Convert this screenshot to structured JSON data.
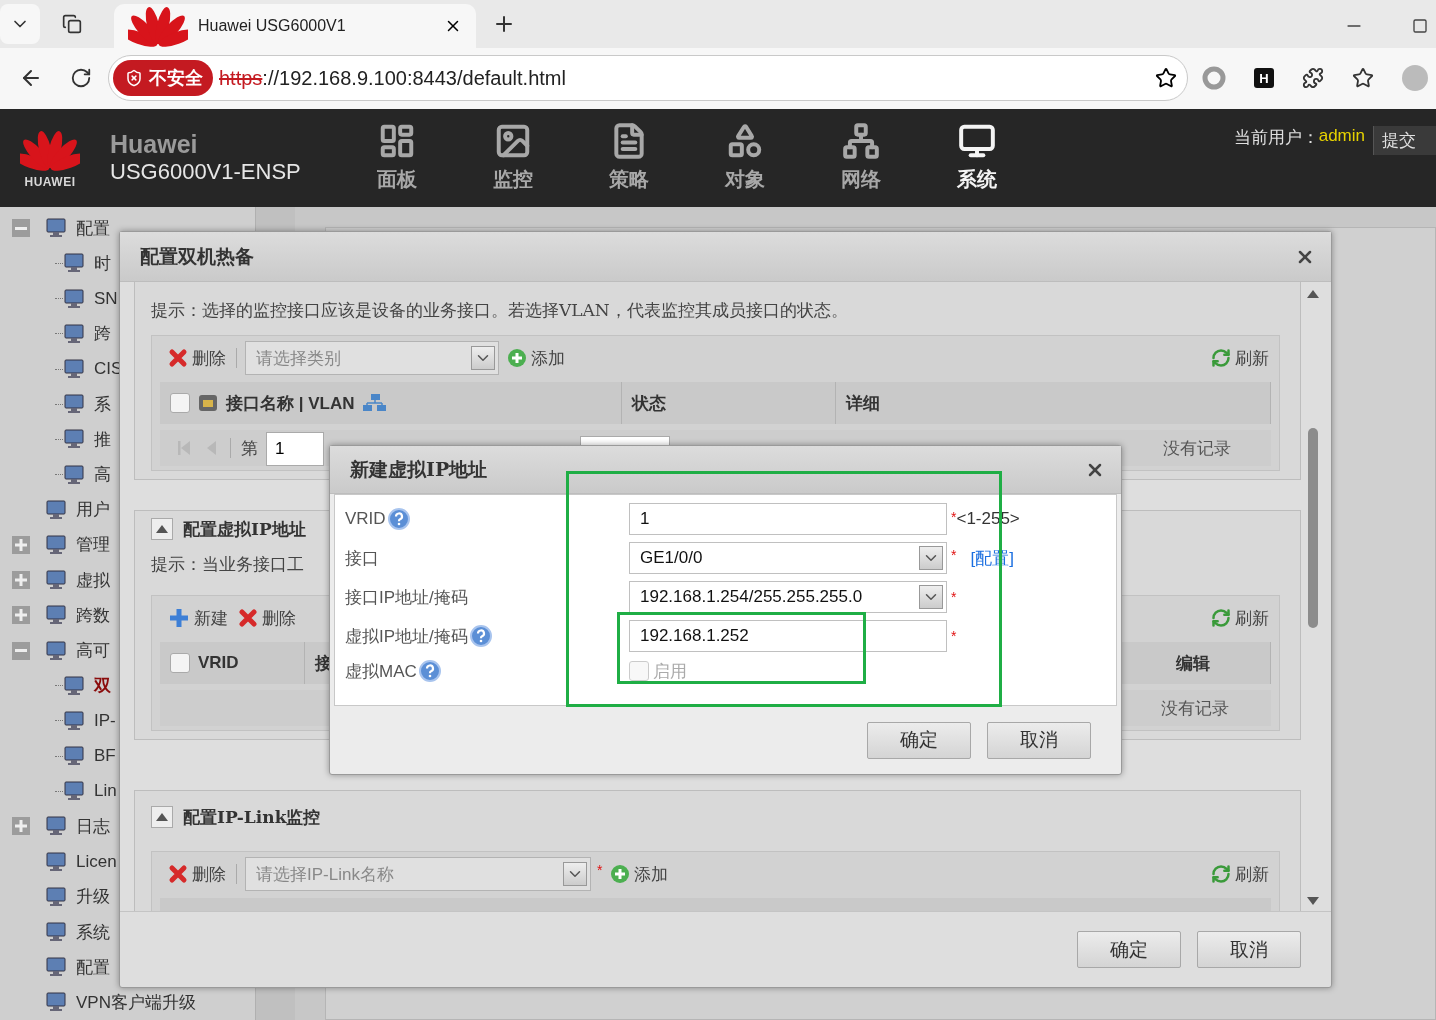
{
  "browser": {
    "tab_title": "Huawei USG6000V1",
    "security_badge": "不安全",
    "url_scheme": "https",
    "url_rest": "://192.168.9.100:8443/default.html",
    "extension_badge": "H"
  },
  "header": {
    "logo_text": "HUAWEI",
    "brand": "Huawei",
    "device": "USG6000V1-ENSP",
    "nav": [
      {
        "label": "面板",
        "kind": "panel",
        "selected": false
      },
      {
        "label": "监控",
        "kind": "monitor",
        "selected": false
      },
      {
        "label": "策略",
        "kind": "policy",
        "selected": false
      },
      {
        "label": "对象",
        "kind": "object",
        "selected": false
      },
      {
        "label": "网络",
        "kind": "network",
        "selected": false
      },
      {
        "label": "系统",
        "kind": "system",
        "selected": true
      }
    ],
    "user_label": "当前用户：",
    "user": "admin",
    "submit": "提交"
  },
  "sidebar": {
    "items": [
      {
        "label": "配置",
        "kind": "folder",
        "expanded": true,
        "children": [
          {
            "label": "时",
            "selected": false
          },
          {
            "label": "SN",
            "selected": false
          },
          {
            "label": "跨",
            "selected": false
          },
          {
            "label": "CIS",
            "selected": false
          },
          {
            "label": "系",
            "selected": false
          },
          {
            "label": "推",
            "selected": false
          },
          {
            "label": "高",
            "selected": false
          }
        ]
      },
      {
        "label": "用户",
        "kind": "leaf"
      },
      {
        "label": "管理",
        "kind": "folder",
        "expanded": false
      },
      {
        "label": "虚拟",
        "kind": "folder",
        "expanded": false
      },
      {
        "label": "跨数",
        "kind": "folder",
        "expanded": false
      },
      {
        "label": "高可",
        "kind": "folder",
        "expanded": true,
        "children": [
          {
            "label": "双",
            "selected": true
          },
          {
            "label": "IP-",
            "selected": false
          },
          {
            "label": "BF",
            "selected": false
          },
          {
            "label": "Lin",
            "selected": false
          }
        ]
      },
      {
        "label": "日志",
        "kind": "folder",
        "expanded": false
      },
      {
        "label": "Licen",
        "kind": "leaf"
      },
      {
        "label": "升级",
        "kind": "leaf"
      },
      {
        "label": "系统",
        "kind": "leaf"
      },
      {
        "label": "配置",
        "kind": "leaf"
      },
      {
        "label": "VPN客户端升级",
        "kind": "leaf"
      }
    ]
  },
  "ha_dialog": {
    "title": "配置双机热备",
    "monitor": {
      "hint": "提示：选择的监控接口应该是设备的业务接口。若选择VLAN，代表监控其成员接口的状态。",
      "delete": "删除",
      "category_placeholder": "请选择类别",
      "add": "添加",
      "refresh": "刷新",
      "select_all": false,
      "columns": [
        "接口名称 | VLAN",
        "状态",
        "详细"
      ],
      "pager": {
        "page_prefix": "第",
        "page": "1"
      },
      "empty": "没有记录"
    },
    "vip": {
      "title": "配置虚拟IP地址",
      "expanded": true,
      "hint": "提示：当业务接口工",
      "new": "新建",
      "delete": "删除",
      "refresh": "刷新",
      "select_all": false,
      "columns": [
        "VRID",
        "接",
        "编辑"
      ],
      "empty": "没有记录"
    },
    "iplink": {
      "title": "配置IP-Link监控",
      "expanded": true,
      "delete": "删除",
      "placeholder": "请选择IP-Link名称",
      "required_mark": "*",
      "add": "添加",
      "refresh": "刷新"
    },
    "buttons": [
      "确定",
      "取消"
    ]
  },
  "vip_dialog": {
    "title": "新建虚拟IP地址",
    "fields": [
      {
        "label": "VRID",
        "help": true,
        "kind": "input",
        "value": "1",
        "required_mark": "*",
        "hint": "<1-255>"
      },
      {
        "label": "接口",
        "help": false,
        "kind": "select",
        "value": "GE1/0/0",
        "required_mark": "*",
        "link": "[配置]"
      },
      {
        "label": "接口IP地址/掩码",
        "help": false,
        "kind": "select",
        "value": "192.168.1.254/255.255.255.0",
        "required_mark": "*"
      },
      {
        "label": "虚拟IP地址/掩码",
        "help": true,
        "kind": "input",
        "value": "192.168.1.252",
        "required_mark": "*"
      },
      {
        "label": "虚拟MAC",
        "help": true,
        "kind": "checkbox",
        "option": "启用",
        "checked": false,
        "disabled": true
      }
    ],
    "buttons": [
      "确定",
      "取消"
    ]
  }
}
